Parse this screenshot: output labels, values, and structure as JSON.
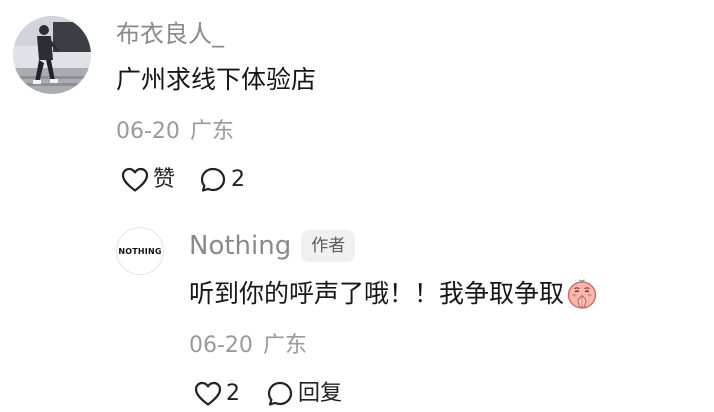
{
  "comment": {
    "username": "布衣良人_",
    "text": "广州求线下体验店",
    "date": "06-20",
    "location": "广东",
    "like_label": "赞",
    "reply_count": "2",
    "avatar_icon": "runner-photo",
    "like_icon": "heart-outline-icon",
    "comment_icon": "comment-bubble-icon"
  },
  "reply": {
    "username": "Nothing",
    "badge": "作者",
    "text": "听到你的呼声了哦！！我争取争取",
    "emoji": "praying-face-emoji",
    "date": "06-20",
    "location": "广东",
    "like_count": "2",
    "reply_label": "回复",
    "avatar_logo_text": "NOTHING",
    "like_icon": "heart-outline-icon",
    "comment_icon": "comment-bubble-icon"
  }
}
